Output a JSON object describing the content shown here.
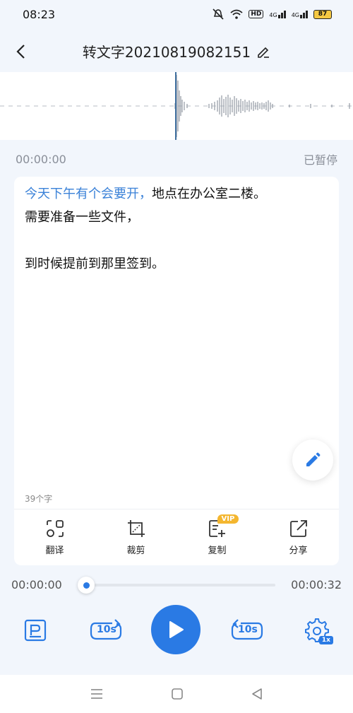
{
  "status_bar": {
    "time": "08:23",
    "battery": "87",
    "hd": "HD",
    "net1": "4G",
    "net2": "4G"
  },
  "header": {
    "title": "转文字20210819082151"
  },
  "playback": {
    "current_time": "00:00:00",
    "state": "已暂停"
  },
  "transcript": {
    "line1_highlight": "今天下午有个会要开，",
    "line1_rest": "地点在办公室二楼。",
    "line2": "需要准备一些文件，",
    "line3": "到时候提前到那里签到。",
    "char_count": "39个字"
  },
  "actions": [
    {
      "label": "翻译",
      "icon": "translate-icon"
    },
    {
      "label": "裁剪",
      "icon": "crop-icon"
    },
    {
      "label": "复制",
      "icon": "copy-icon",
      "badge": "VIP"
    },
    {
      "label": "分享",
      "icon": "share-icon"
    }
  ],
  "progress": {
    "start": "00:00:00",
    "end": "00:00:32",
    "fraction": 0.0
  },
  "controls": {
    "rewind": "10s",
    "forward": "10s",
    "speed": "1x"
  },
  "colors": {
    "accent": "#2a7ae4",
    "highlight_text": "#3b82d8",
    "vip": "#f4b62f"
  }
}
